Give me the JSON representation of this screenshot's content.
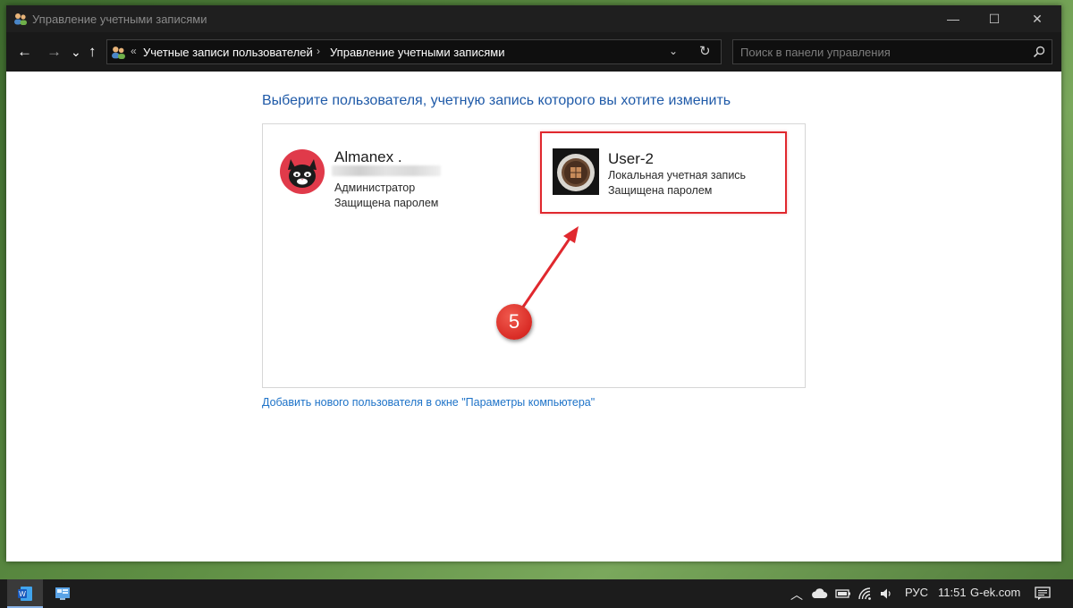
{
  "window": {
    "title": "Управление учетными записями"
  },
  "title_controls": {
    "minimize": "—",
    "maximize": "☐",
    "close": "✕"
  },
  "nav": {
    "back": "←",
    "forward": "→",
    "recent": "⌄",
    "up": "↑"
  },
  "address": {
    "chevron": "«",
    "breadcrumb": [
      "Учетные записи пользователей",
      "Управление учетными записями"
    ],
    "separator": "›",
    "dropdown": "⌄",
    "refresh": "↻"
  },
  "search": {
    "placeholder": "Поиск в панели управления"
  },
  "main": {
    "heading": "Выберите пользователя, учетную запись которого вы хотите изменить",
    "add_user_link": "Добавить нового пользователя в окне \"Параметры компьютера\""
  },
  "accounts": [
    {
      "name": "Almanex .",
      "role": "Администратор",
      "status": "Защищена паролем",
      "avatar_icon": "cat-avatar-icon"
    },
    {
      "name": "User-2",
      "role": "Локальная учетная запись",
      "status": "Защищена паролем",
      "avatar_icon": "coffee-cup-avatar-icon"
    }
  ],
  "annotation": {
    "step_number": "5",
    "color": "#e0282e"
  },
  "taskbar": {
    "language": "РУС",
    "time": "11:51",
    "site": "G-ek.com"
  }
}
